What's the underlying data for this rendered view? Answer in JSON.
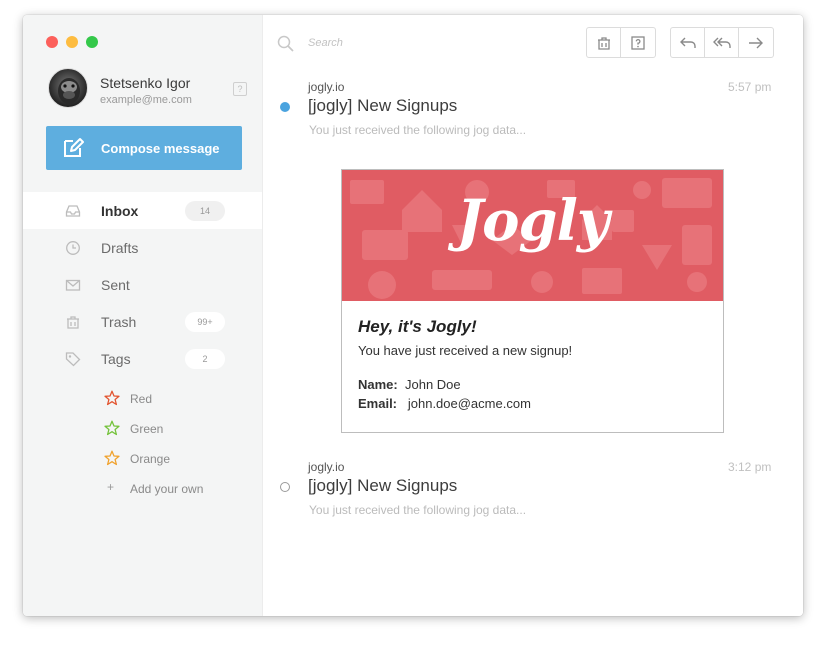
{
  "window": {
    "traffic_lights": {
      "red": "#fc605b",
      "yellow": "#fdbc40",
      "green": "#34c84a"
    }
  },
  "profile": {
    "name": "Stetsenko Igor",
    "email": "example@me.com",
    "help_icon": "question-icon"
  },
  "compose": {
    "label": "Compose message",
    "icon": "compose-icon",
    "color": "#5eaedf"
  },
  "nav": [
    {
      "label": "Inbox",
      "icon": "inbox-icon",
      "badge": "14",
      "active": true
    },
    {
      "label": "Drafts",
      "icon": "clock-icon",
      "badge": null
    },
    {
      "label": "Sent",
      "icon": "envelope-icon",
      "badge": null
    },
    {
      "label": "Trash",
      "icon": "trash-icon",
      "badge": "99+"
    },
    {
      "label": "Tags",
      "icon": "tag-icon",
      "badge": "2"
    }
  ],
  "tags": [
    {
      "label": "Red",
      "color": "#e2542f"
    },
    {
      "label": "Green",
      "color": "#74c23b"
    },
    {
      "label": "Orange",
      "color": "#f0a22e"
    }
  ],
  "add_tag_label": "Add your own",
  "toolbar": {
    "search_placeholder": "Search",
    "buttons": [
      "trash-icon",
      "question-icon",
      "reply-icon",
      "reply-all-icon",
      "forward-icon"
    ]
  },
  "messages": [
    {
      "from": "jogly.io",
      "time": "5:57 pm",
      "subject": "[jogly] New Signups",
      "preview": "You just received the following jog data...",
      "unread": true,
      "unread_color": "#4aa3df",
      "card": {
        "brand": "Jogly",
        "banner_color": "#e05c63",
        "title": "Hey, it's Jogly!",
        "subtitle": "You have just received a new signup!",
        "name_label": "Name:",
        "name_value": "John Doe",
        "email_label": "Email:",
        "email_value": "john.doe@acme.com"
      }
    },
    {
      "from": "jogly.io",
      "time": "3:12 pm",
      "subject": "[jogly] New Signups",
      "preview": "You just received the following jog data...",
      "unread": false
    }
  ]
}
